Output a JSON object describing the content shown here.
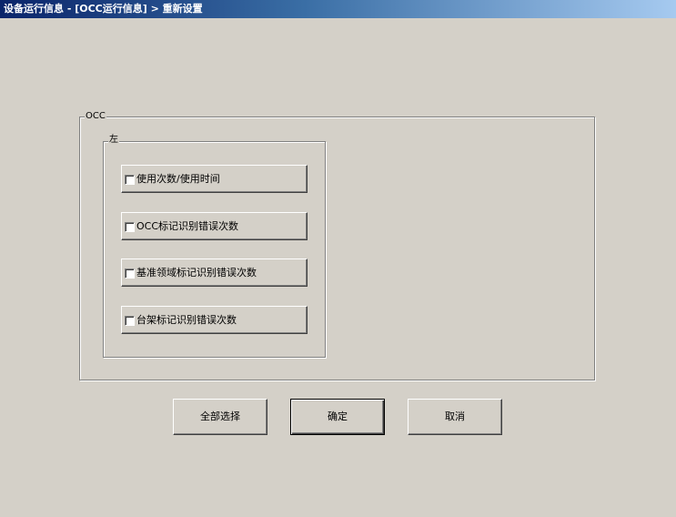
{
  "window": {
    "title": "设备运行信息 - [OCC运行信息] > 重新设置"
  },
  "occ_group": {
    "label": "OCC"
  },
  "left_group": {
    "label": "左"
  },
  "options": [
    {
      "label": "使用次数/使用时间",
      "checked": false
    },
    {
      "label": "OCC标记识别错误次数",
      "checked": false
    },
    {
      "label": "基准领域标记识别错误次数",
      "checked": false
    },
    {
      "label": "台架标记识别错误次数",
      "checked": false
    }
  ],
  "buttons": {
    "select_all": "全部选择",
    "ok": "确定",
    "cancel": "取消"
  }
}
